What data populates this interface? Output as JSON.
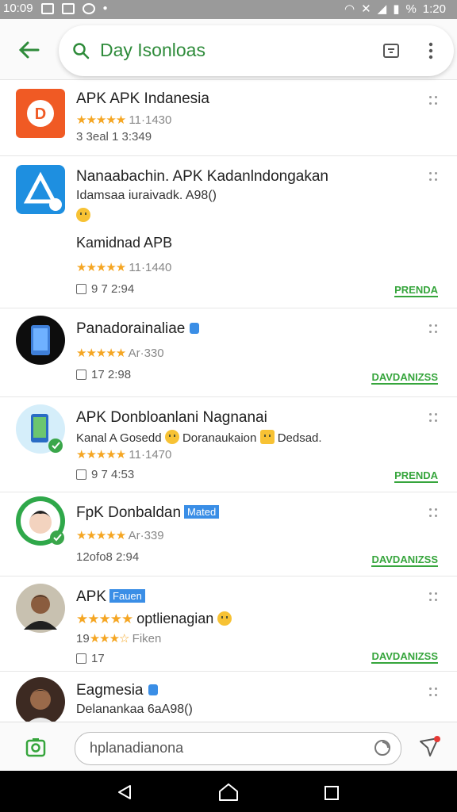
{
  "status": {
    "time_left": "10:09",
    "time_right": "1:20",
    "percent": "%"
  },
  "search": {
    "query": "Day Isonloas"
  },
  "items": [
    {
      "title": "APK APK Indanesia",
      "rating_text": "11·1430",
      "line2": "3 3eal 1 3:349"
    },
    {
      "title": "Nanaabachin. APK Kadanlndongakan",
      "sub": "Idamsaa iuraivadk. A98()",
      "sub2": "Kamidnad APB",
      "rating_text": "11·1440",
      "meta": "9 7 2:94",
      "action": "PRENDA"
    },
    {
      "title": "Panadorainaliae",
      "rating_text": "Ar·330",
      "meta": "17 2:98",
      "action": "DAVDANIZSS"
    },
    {
      "title": "APK Donbloanlani Nagnanai",
      "sub_a": "Kanal A Gosedd",
      "sub_b": "Doranaukaion",
      "sub_c": "Dedsad.",
      "rating_text": "11·1470",
      "meta": "9 7 4:53",
      "action": "PRENDA"
    },
    {
      "title": "FpK Donbaldan",
      "badge": "Mated",
      "rating_text": "Ar·339",
      "line2": "12ofo8 2:94",
      "action": "DAVDANIZSS"
    },
    {
      "title": "APK",
      "badge": "Fauen",
      "sub": "optlienagian",
      "rating_text": "Fiken",
      "rating_prefix": "19",
      "meta": "17",
      "action": "DAVDANIZSS"
    },
    {
      "title": "Eagmesia",
      "sub": "Delanankaa 6aA98()"
    }
  ],
  "bottom": {
    "placeholder": "hplanadianona"
  },
  "colors": {
    "accent": "#36a53c",
    "star": "#f5a623",
    "blue_badge": "#3a8ee6"
  }
}
